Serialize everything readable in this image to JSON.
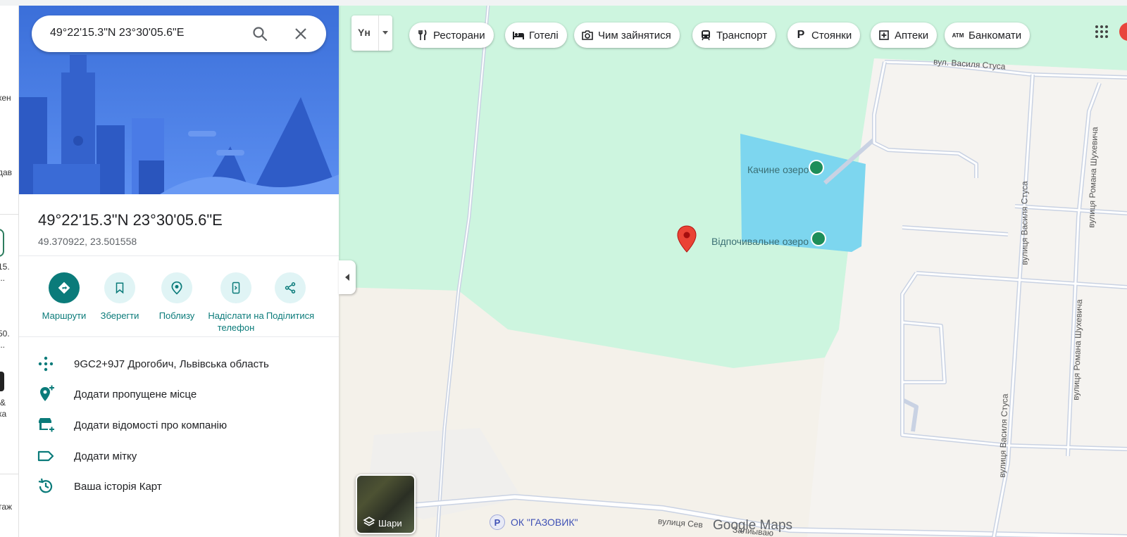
{
  "rail": {
    "items": [
      "кен",
      "дав",
      "15.",
      "...",
      "50.",
      "...",
      "&",
      "ка",
      "таж"
    ]
  },
  "search": {
    "value": "49°22'15.3\"N 23°30'05.6\"E"
  },
  "place": {
    "title": "49°22'15.3\"N 23°30'05.6\"E",
    "coords": "49.370922, 23.501558"
  },
  "actions": [
    {
      "label": "Маршрути",
      "icon": "directions-icon"
    },
    {
      "label": "Зберегти",
      "icon": "bookmark-icon"
    },
    {
      "label": "Поблизу",
      "icon": "nearby-icon"
    },
    {
      "label": "Надіслати на телефон",
      "icon": "send-to-phone-icon"
    },
    {
      "label": "Поділитися",
      "icon": "share-icon"
    }
  ],
  "info": [
    {
      "text": "9GC2+9J7 Дрогобич, Львівська область",
      "icon": "plus-code-icon"
    },
    {
      "text": "Додати пропущене місце",
      "icon": "add-place-icon"
    },
    {
      "text": "Додати відомості про компанію",
      "icon": "add-business-icon"
    },
    {
      "text": "Додати мітку",
      "icon": "label-icon"
    },
    {
      "text": "Ваша історія Карт",
      "icon": "history-icon"
    }
  ],
  "lang": {
    "label": "Yн"
  },
  "chips": [
    {
      "label": "Ресторани",
      "icon": "restaurant-icon"
    },
    {
      "label": "Готелі",
      "icon": "hotel-icon"
    },
    {
      "label": "Чим зайнятися",
      "icon": "camera-icon"
    },
    {
      "label": "Транспорт",
      "icon": "transit-icon"
    },
    {
      "label": "Стоянки",
      "icon": "parking-icon"
    },
    {
      "label": "Аптеки",
      "icon": "pharmacy-icon"
    },
    {
      "label": "Банкомати",
      "icon": "atm-icon"
    }
  ],
  "map": {
    "lake1": "Качине озеро",
    "lake2": "Відпочивальне озеро",
    "streets": {
      "stusa_top": "вул. Василя Стуса",
      "stusa_v1": "вулиця Василя Стуса",
      "stusa_v2": "вулиця Василя Стуса",
      "shukh_v1": "вулиця Романа Шухевича",
      "shukh_v2": "вулиця Романа Шухевича",
      "sev": "вулиця Сев",
      "sev2": "Залиываю"
    },
    "parking_name": "ОК \"ГАЗОВИК\"",
    "layers_label": "Шари",
    "logo": "Google Maps"
  },
  "colors": {
    "accent": "#0b7b7a",
    "park": "#cdf5df",
    "water": "#7dd6ef",
    "land": "#f4f1ea",
    "road": "#c9d2e3",
    "pin": "#ea4335"
  }
}
